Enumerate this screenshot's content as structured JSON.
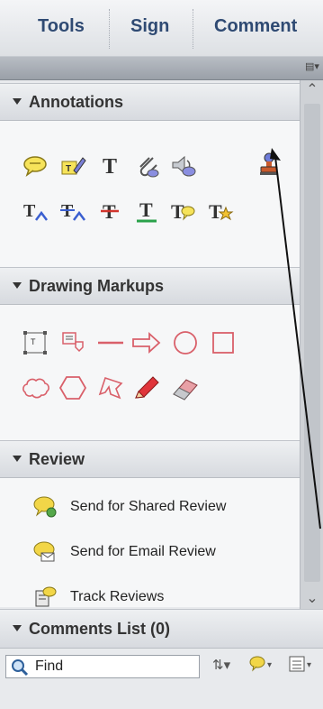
{
  "tabs": [
    "Tools",
    "Sign",
    "Comment"
  ],
  "sections": {
    "annotations": {
      "title": "Annotations"
    },
    "drawing": {
      "title": "Drawing Markups"
    },
    "review": {
      "title": "Review"
    },
    "comments": {
      "title": "Comments List (0)"
    }
  },
  "review_items": [
    {
      "label": "Send for Shared Review"
    },
    {
      "label": "Send for Email Review"
    },
    {
      "label": "Track Reviews"
    }
  ],
  "find": {
    "label": "Find"
  }
}
